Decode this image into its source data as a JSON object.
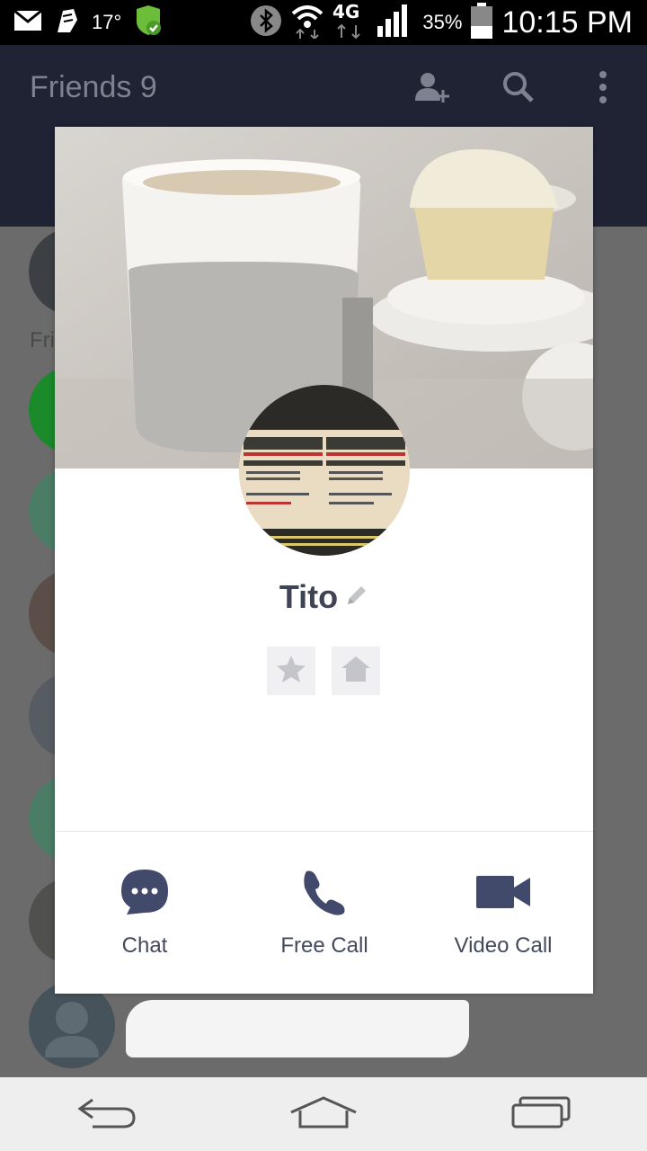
{
  "status_bar": {
    "temperature": "17°",
    "network": "4G",
    "battery": "35%",
    "time": "10:15 PM",
    "icons": [
      "mail-icon",
      "app-icon",
      "shield-check-icon",
      "bluetooth-icon",
      "wifi-icon",
      "lte-icon",
      "signal-icon",
      "battery-icon"
    ]
  },
  "header": {
    "title": "Friends 9",
    "icons": [
      "add-friend-icon",
      "search-icon",
      "more-icon"
    ]
  },
  "list": {
    "section_label": "Fri"
  },
  "profile": {
    "name": "Tito",
    "edit_icon": "pencil-icon",
    "favorite_icon": "star-icon",
    "home_icon": "home-icon"
  },
  "actions": [
    {
      "label": "Chat",
      "icon": "chat-bubble-icon"
    },
    {
      "label": "Free Call",
      "icon": "phone-icon"
    },
    {
      "label": "Video Call",
      "icon": "video-camera-icon"
    }
  ],
  "nav": {
    "icons": [
      "back-icon",
      "home-nav-icon",
      "recents-icon"
    ]
  },
  "colors": {
    "accent": "#3e4356",
    "header_bg": "#1f2333"
  }
}
